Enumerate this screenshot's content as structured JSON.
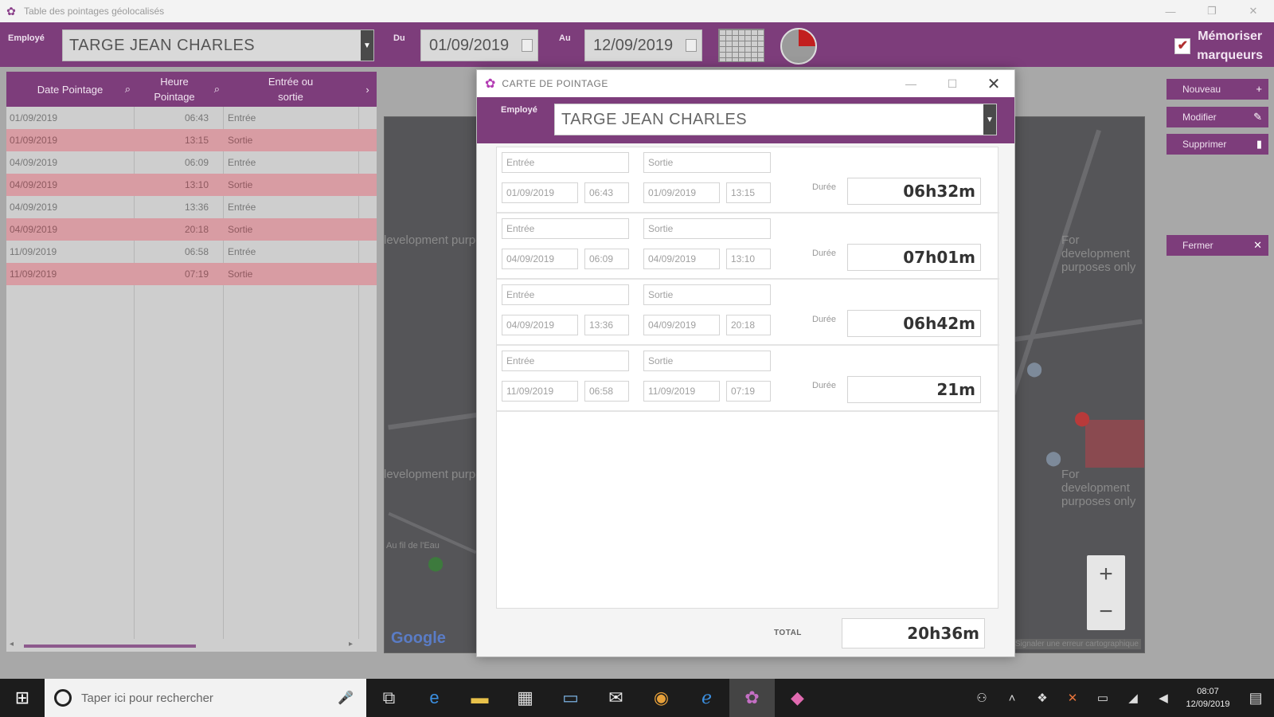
{
  "window": {
    "title": "Table des pointages géolocalisés",
    "controls": [
      "—",
      "❐",
      "✕"
    ]
  },
  "toolbar": {
    "employee_label": "Employé",
    "employee_value": "TARGE JEAN CHARLES",
    "from_label": "Du",
    "from_date": "01/09/2019",
    "to_label": "Au",
    "to_date": "12/09/2019",
    "memo_line1": "Mémoriser",
    "memo_line2": "marqueurs",
    "memo_checked": "✔"
  },
  "grid": {
    "columns": [
      "Date Pointage",
      "Heure Pointage",
      "Entrée ou sortie"
    ],
    "rows": [
      {
        "date": "01/09/2019",
        "time": "06:43",
        "type": "Entrée",
        "kind": "in"
      },
      {
        "date": "01/09/2019",
        "time": "13:15",
        "type": "Sortie",
        "kind": "out"
      },
      {
        "date": "04/09/2019",
        "time": "06:09",
        "type": "Entrée",
        "kind": "in"
      },
      {
        "date": "04/09/2019",
        "time": "13:10",
        "type": "Sortie",
        "kind": "out"
      },
      {
        "date": "04/09/2019",
        "time": "13:36",
        "type": "Entrée",
        "kind": "in"
      },
      {
        "date": "04/09/2019",
        "time": "20:18",
        "type": "Sortie",
        "kind": "out"
      },
      {
        "date": "11/09/2019",
        "time": "06:58",
        "type": "Entrée",
        "kind": "in"
      },
      {
        "date": "11/09/2019",
        "time": "07:19",
        "type": "Sortie",
        "kind": "out"
      }
    ]
  },
  "map": {
    "watermark": "development purposes only",
    "watermark_right": "For development purposes only",
    "place_label": "Au fil de l'Eau",
    "google": "Google",
    "error_text": "Signaler une erreur cartographique",
    "zoom_in": "+",
    "zoom_out": "−"
  },
  "side_buttons": {
    "new": "Nouveau",
    "edit": "Modifier",
    "delete": "Supprimer",
    "close": "Fermer"
  },
  "dialog": {
    "title": "CARTE DE POINTAGE",
    "employee_label": "Employé",
    "employee_value": "TARGE JEAN CHARLES",
    "entry_label": "Entrée",
    "exit_label": "Sortie",
    "duration_label": "Durée",
    "total_label": "TOTAL",
    "total_value": "20h36m",
    "cards": [
      {
        "in_date": "01/09/2019",
        "in_time": "06:43",
        "out_date": "01/09/2019",
        "out_time": "13:15",
        "duration": "06h32m"
      },
      {
        "in_date": "04/09/2019",
        "in_time": "06:09",
        "out_date": "04/09/2019",
        "out_time": "13:10",
        "duration": "07h01m"
      },
      {
        "in_date": "04/09/2019",
        "in_time": "13:36",
        "out_date": "04/09/2019",
        "out_time": "20:18",
        "duration": "06h42m"
      },
      {
        "in_date": "11/09/2019",
        "in_time": "06:58",
        "out_date": "11/09/2019",
        "out_time": "07:19",
        "duration": "21m"
      }
    ]
  },
  "taskbar": {
    "search_placeholder": "Taper ici pour rechercher",
    "time": "08:07",
    "date": "12/09/2019"
  },
  "colors": {
    "accent": "#7d3d7b",
    "row_out": "#d89ca3"
  }
}
